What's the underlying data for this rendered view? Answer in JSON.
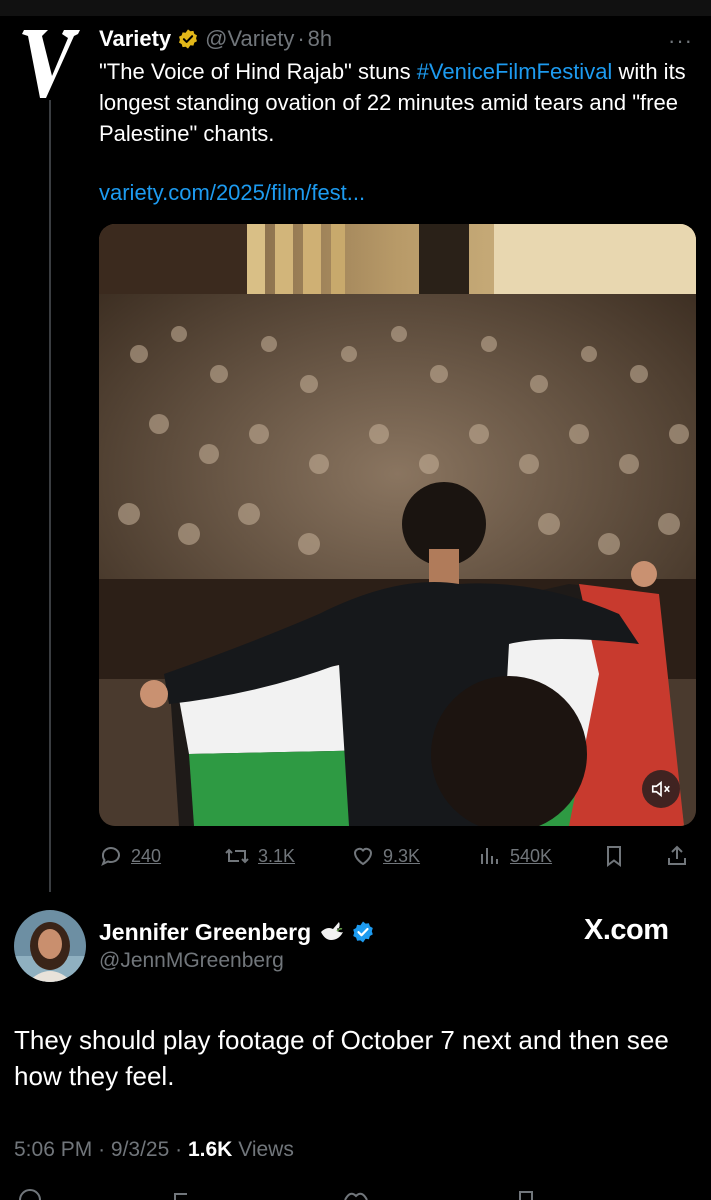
{
  "quoted_tweet": {
    "account_name": "Variety",
    "handle": "@Variety",
    "separator": "·",
    "time": "8h",
    "text_before": "\"The Voice of Hind Rajab\" stuns ",
    "hashtag": "#VeniceFilmFestival",
    "text_after": " with its longest standing ovation of 22 minutes amid tears and \"free Palestine\" chants.",
    "link": "variety.com/2025/film/fest...",
    "more_label": "···",
    "actions": {
      "replies": "240",
      "reposts": "3.1K",
      "likes": "9.3K",
      "views": "540K"
    },
    "icons": [
      "variety-logo-icon",
      "gold-verified-badge-icon",
      "more-icon",
      "mute-icon",
      "reply-icon",
      "repost-icon",
      "like-icon",
      "views-icon",
      "bookmark-icon",
      "share-icon"
    ]
  },
  "main_tweet": {
    "display_name": "Jennifer Greenberg",
    "handle": "@JennMGreenberg",
    "brand": "X.com",
    "text": "They should play footage of October 7 next and then see how they feel.",
    "time": "5:06 PM",
    "date": "9/3/25",
    "separator": "·",
    "views_count": "1.6K",
    "views_label": "Views",
    "icons": [
      "avatar",
      "dove-icon",
      "blue-verified-badge-icon"
    ]
  },
  "colors": {
    "background": "#000000",
    "text": "#e7e9ea",
    "muted": "#71767b",
    "link": "#1d9bf0",
    "gold_badge": "#e2b719"
  }
}
